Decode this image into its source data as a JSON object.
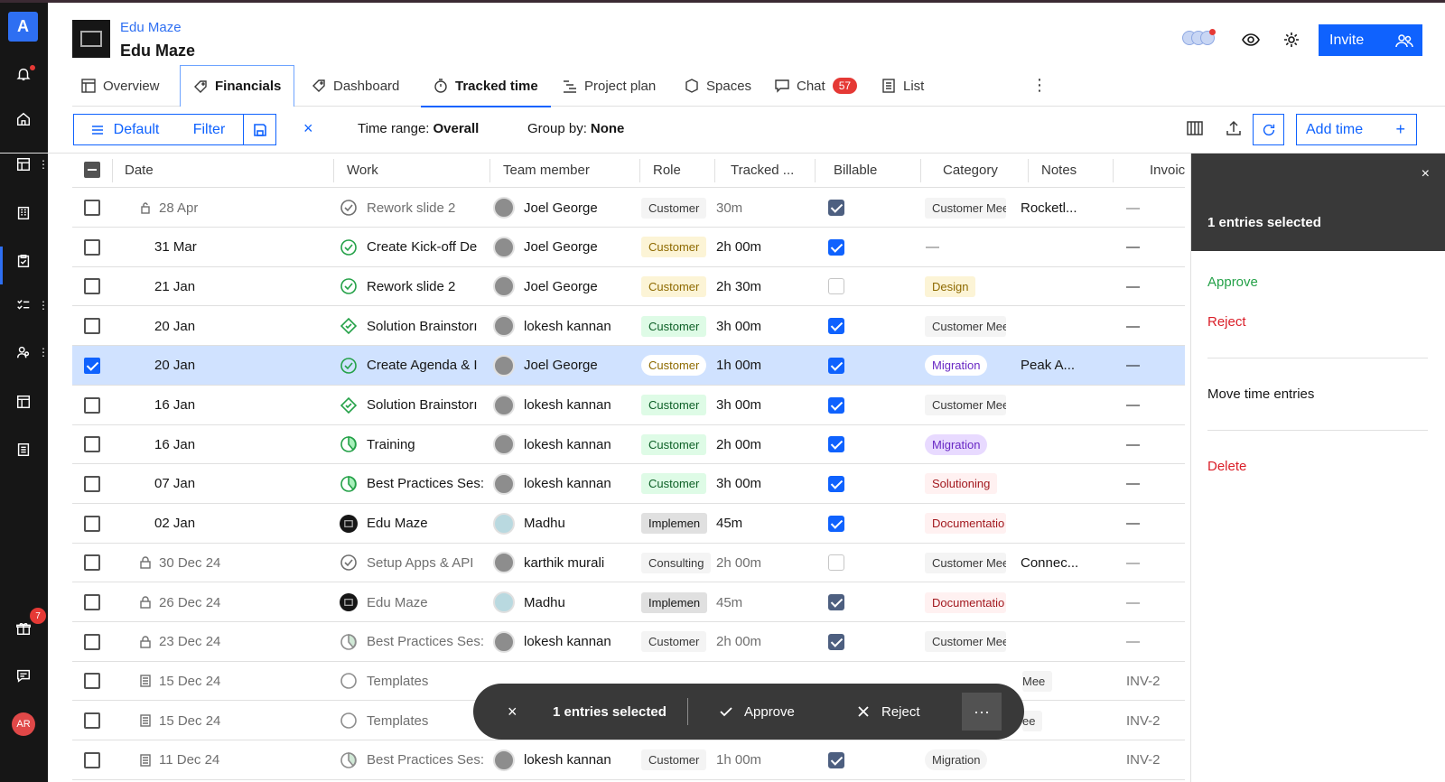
{
  "project": {
    "subtitle": "Edu Maze",
    "title": "Edu Maze"
  },
  "rail": {
    "logo": "A",
    "gift_badge": "7",
    "avatar": "AR"
  },
  "header": {
    "invite_label": "Invite"
  },
  "tabs": [
    {
      "label": "Overview",
      "icon": "layout-icon"
    },
    {
      "label": "Financials",
      "icon": "tag-icon"
    },
    {
      "label": "Dashboard",
      "icon": "tag-icon"
    },
    {
      "label": "Tracked time",
      "icon": "timer-icon"
    },
    {
      "label": "Project plan",
      "icon": "gantt-icon"
    },
    {
      "label": "Spaces",
      "icon": "cube-icon"
    },
    {
      "label": "Chat",
      "icon": "chat-icon",
      "badge": "57"
    },
    {
      "label": "List",
      "icon": "list-icon"
    }
  ],
  "toolbar": {
    "default_label": "Default",
    "filter_label": "Filter",
    "time_range_label": "Time range:",
    "time_range_value": "Overall",
    "group_by_label": "Group by:",
    "group_by_value": "None",
    "add_time_label": "Add time",
    "add_symbol": "+"
  },
  "columns": [
    "Date",
    "Work",
    "Team member",
    "Role",
    "Tracked ...",
    "Billable",
    "Category",
    "Notes",
    "Invoic"
  ],
  "rows": [
    {
      "date": "28 Apr",
      "lock": "hourglass",
      "work": "Rework slide 2",
      "wicon": "check",
      "member": "Joel George",
      "role": "Customer",
      "role_style": "plain",
      "tracked": "30m",
      "billable": "dim",
      "category": "Customer Mee",
      "cat_style": "plain",
      "notes": "Rocketl...",
      "invoice": "—",
      "dimmed": true
    },
    {
      "date": "31 Mar",
      "lock": "",
      "work": "Create Kick-off De",
      "wicon": "check-g",
      "member": "Joel George",
      "role": "Customer",
      "role_style": "yellow",
      "tracked": "2h 00m",
      "billable": "on",
      "category": "—",
      "cat_style": "none",
      "notes": "",
      "invoice": "—",
      "dimmed": false
    },
    {
      "date": "21 Jan",
      "lock": "",
      "work": "Rework slide 2",
      "wicon": "check-g",
      "member": "Joel George",
      "role": "Customer",
      "role_style": "yellow",
      "tracked": "2h 30m",
      "billable": "off",
      "category": "Design",
      "cat_style": "design",
      "notes": "",
      "invoice": "—",
      "dimmed": false
    },
    {
      "date": "20 Jan",
      "lock": "",
      "work": "Solution Brainstorı",
      "wicon": "diamond",
      "member": "lokesh kannan",
      "role": "Customer",
      "role_style": "green",
      "tracked": "3h 00m",
      "billable": "on",
      "category": "Customer Mee",
      "cat_style": "plain",
      "notes": "",
      "invoice": "—",
      "dimmed": false
    },
    {
      "date": "20 Jan",
      "lock": "",
      "work": "Create Agenda & I",
      "wicon": "check-g",
      "member": "Joel George",
      "role": "Customer",
      "role_style": "white",
      "tracked": "1h 00m",
      "billable": "on",
      "category": "Migration",
      "cat_style": "mig-sel",
      "notes": "Peak A...",
      "invoice": "—",
      "dimmed": false,
      "selected": true
    },
    {
      "date": "16 Jan",
      "lock": "",
      "work": "Solution Brainstorı",
      "wicon": "diamond",
      "member": "lokesh kannan",
      "role": "Customer",
      "role_style": "green",
      "tracked": "3h 00m",
      "billable": "on",
      "category": "Customer Mee",
      "cat_style": "plain",
      "notes": "",
      "invoice": "—",
      "dimmed": false
    },
    {
      "date": "16 Jan",
      "lock": "",
      "work": "Training",
      "wicon": "progress-g",
      "member": "lokesh kannan",
      "role": "Customer",
      "role_style": "green",
      "tracked": "2h 00m",
      "billable": "on",
      "category": "Migration",
      "cat_style": "mig",
      "notes": "",
      "invoice": "—",
      "dimmed": false
    },
    {
      "date": "07 Jan",
      "lock": "",
      "work": "Best Practices Ses:",
      "wicon": "progress-g",
      "member": "lokesh kannan",
      "role": "Customer",
      "role_style": "green",
      "tracked": "3h 00m",
      "billable": "on",
      "category": "Solutioning",
      "cat_style": "sol",
      "notes": "",
      "invoice": "—",
      "dimmed": false
    },
    {
      "date": "02 Jan",
      "lock": "",
      "work": "Edu Maze",
      "wicon": "project",
      "member": "Madhu",
      "role": "Implemen",
      "role_style": "impl",
      "tracked": "45m",
      "billable": "on",
      "category": "Documentatio",
      "cat_style": "doc",
      "notes": "",
      "invoice": "—",
      "dimmed": false,
      "mav": true
    },
    {
      "date": "30 Dec 24",
      "lock": "lock",
      "work": "Setup Apps & API",
      "wicon": "check",
      "member": "karthik murali",
      "role": "Consulting",
      "role_style": "plain",
      "tracked": "2h 00m",
      "billable": "off",
      "category": "Customer Mee",
      "cat_style": "plain",
      "notes": "Connec...",
      "invoice": "—",
      "dimmed": true
    },
    {
      "date": "26 Dec 24",
      "lock": "lock",
      "work": "Edu Maze",
      "wicon": "project",
      "member": "Madhu",
      "role": "Implemen",
      "role_style": "impl",
      "tracked": "45m",
      "billable": "dim",
      "category": "Documentatio",
      "cat_style": "doc",
      "notes": "",
      "invoice": "—",
      "dimmed": true,
      "mav": true
    },
    {
      "date": "23 Dec 24",
      "lock": "lock",
      "work": "Best Practices Ses:",
      "wicon": "progress",
      "member": "lokesh kannan",
      "role": "Customer",
      "role_style": "plain",
      "tracked": "2h 00m",
      "billable": "dim",
      "category": "Customer Mee",
      "cat_style": "plain",
      "notes": "",
      "invoice": "—",
      "dimmed": true
    },
    {
      "date": "15 Dec 24",
      "lock": "doc",
      "work": "Templates",
      "wicon": "circle",
      "member": "",
      "role": "",
      "role_style": "none",
      "tracked": "",
      "billable": "none",
      "category": "Mee",
      "cat_style": "partial",
      "notes": "",
      "invoice": "INV-2",
      "dimmed": true
    },
    {
      "date": "15 Dec 24",
      "lock": "doc",
      "work": "Templates",
      "wicon": "circle",
      "member": "",
      "role": "",
      "role_style": "none",
      "tracked": "",
      "billable": "none",
      "category": "ee",
      "cat_style": "partial",
      "notes": "",
      "invoice": "INV-2",
      "dimmed": true
    },
    {
      "date": "11 Dec 24",
      "lock": "doc",
      "work": "Best Practices Ses:",
      "wicon": "progress",
      "member": "lokesh kannan",
      "role": "Customer",
      "role_style": "plain",
      "tracked": "1h 00m",
      "billable": "dim",
      "category": "Migration",
      "cat_style": "plain-pill",
      "notes": "",
      "invoice": "INV-2",
      "dimmed": true
    }
  ],
  "panel": {
    "close": "×",
    "title": "1 entries selected",
    "approve": "Approve",
    "reject": "Reject",
    "move": "Move time entries",
    "delete": "Delete"
  },
  "bottom_bar": {
    "close": "×",
    "selected": "1 entries selected",
    "approve": "Approve",
    "reject": "Reject",
    "more": "···"
  },
  "colors": {
    "accent": "#0f62fe",
    "approve": "#24a148",
    "reject": "#da1e28",
    "selected_row": "#d0e2ff"
  }
}
